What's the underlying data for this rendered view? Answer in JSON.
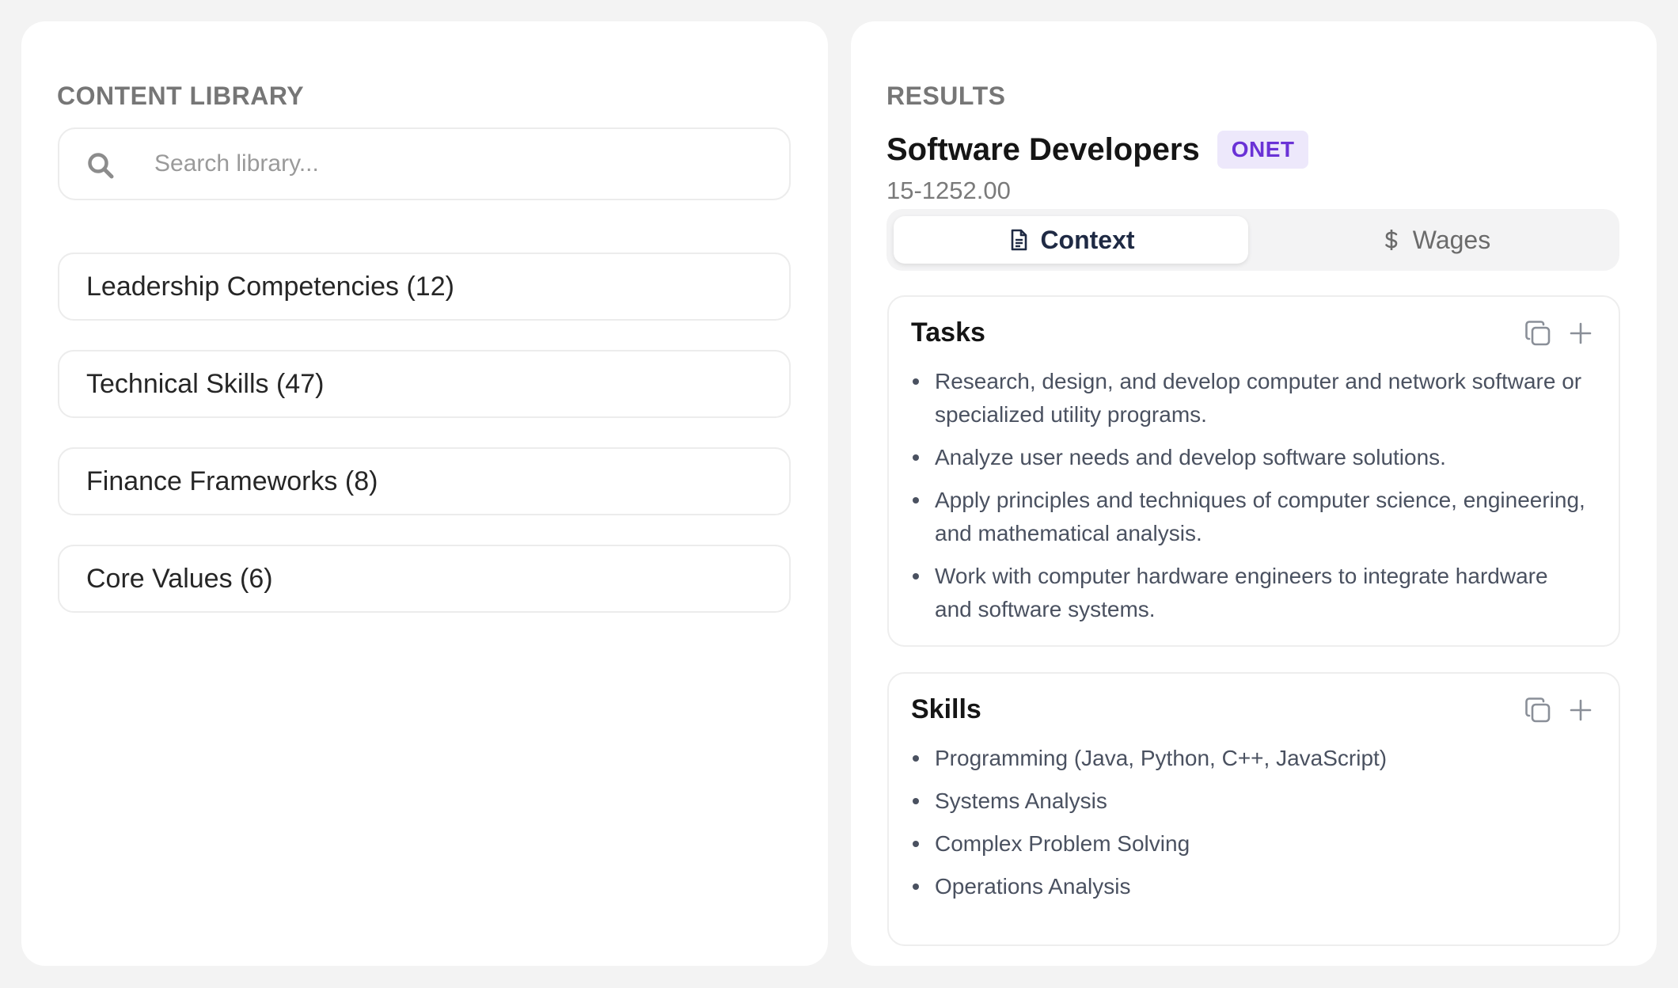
{
  "library": {
    "heading": "CONTENT LIBRARY",
    "search": {
      "placeholder": "Search library...",
      "value": ""
    },
    "items": [
      {
        "label": "Leadership Competencies (12)"
      },
      {
        "label": "Technical Skills (47)"
      },
      {
        "label": "Finance Frameworks (8)"
      },
      {
        "label": "Core Values (6)"
      }
    ]
  },
  "results": {
    "heading": "RESULTS",
    "occupation": {
      "title": "Software Developers",
      "badge": "ONET",
      "code": "15-1252.00"
    },
    "tabs": [
      {
        "label": "Context",
        "icon": "document-icon",
        "active": true
      },
      {
        "label": "Wages",
        "icon": "dollar-icon",
        "active": false
      }
    ],
    "tasks": {
      "title": "Tasks",
      "items": [
        "Research, design, and develop computer and network software or specialized utility programs.",
        "Analyze user needs and develop software solutions.",
        "Apply principles and techniques of computer science, engineering, and mathematical analysis.",
        "Work with computer hardware engineers to integrate hardware and software systems."
      ]
    },
    "skills": {
      "title": "Skills",
      "items": [
        "Programming (Java, Python, C++, JavaScript)",
        "Systems Analysis",
        "Complex Problem Solving",
        "Operations Analysis"
      ]
    }
  },
  "colors": {
    "background": "#f3f3f3",
    "panel": "#ffffff",
    "badge_bg": "#ede8fb",
    "badge_text": "#6a32d6",
    "active_tab_text": "#1f2a44",
    "muted_text": "#767676"
  }
}
